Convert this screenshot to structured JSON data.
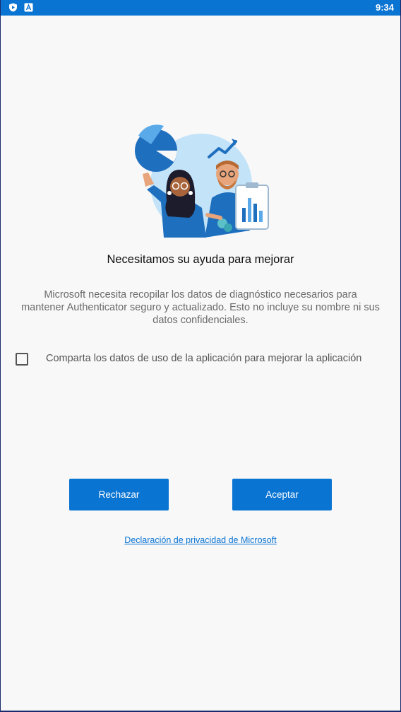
{
  "status_bar": {
    "time": "9:34",
    "icons": [
      "play-protect-icon",
      "app-notification-icon"
    ]
  },
  "colors": {
    "accent": "#0a74d2",
    "background": "#f8f8f9",
    "title_text": "#111111",
    "body_text": "#6a6a6a"
  },
  "main": {
    "title": "Necesitamos su ayuda para mejorar",
    "description_lines": [
      "Microsoft necesita recopilar los datos de diagnóstico necesarios para",
      "mantener Authenticator seguro y actualizado. Esto no incluye su nombre ni sus",
      "datos confidenciales."
    ],
    "consent": {
      "label": "Comparta los datos de uso de la aplicación para mejorar la aplicación",
      "checked": false
    },
    "buttons": {
      "reject": "Rechazar",
      "accept": "Aceptar"
    },
    "privacy_link": "Declaración de privacidad de Microsoft"
  }
}
